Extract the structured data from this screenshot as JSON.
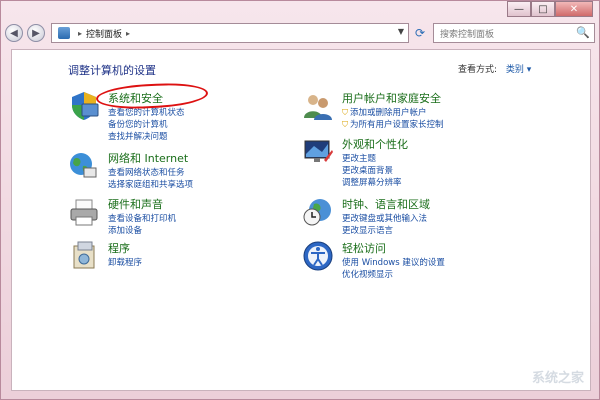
{
  "window": {
    "caption": {
      "minimize": "—",
      "maximize": "□",
      "close": "✕"
    }
  },
  "toolbar": {
    "back_glyph": "◀",
    "forward_glyph": "▶",
    "address_path": [
      "控制面板"
    ],
    "address_sep": "▸",
    "address_drop": "▼",
    "refresh_glyph": "⟳",
    "search_placeholder": "搜索控制面板",
    "search_glyph": "🔍"
  },
  "page": {
    "title": "调整计算机的设置",
    "view_label": "查看方式:",
    "view_value": "类别 ▾"
  },
  "categories": [
    {
      "title": "系统和安全",
      "icon": "shield-icon",
      "links": [
        "查看您的计算机状态",
        "备份您的计算机",
        "查找并解决问题"
      ]
    },
    {
      "title": "网络和 Internet",
      "icon": "network-globe-icon",
      "links": [
        "查看网络状态和任务",
        "选择家庭组和共享选项"
      ]
    },
    {
      "title": "硬件和声音",
      "icon": "printer-icon",
      "links": [
        "查看设备和打印机",
        "添加设备"
      ]
    },
    {
      "title": "程序",
      "icon": "programs-box-icon",
      "links": [
        "卸载程序"
      ]
    },
    {
      "title": "用户帐户和家庭安全",
      "icon": "users-icon",
      "links": [
        "添加或删除用户帐户",
        "为所有用户设置家长控制"
      ]
    },
    {
      "title": "外观和个性化",
      "icon": "display-icon",
      "links": [
        "更改主题",
        "更改桌面背景",
        "调整屏幕分辨率"
      ]
    },
    {
      "title": "时钟、语言和区域",
      "icon": "clock-globe-icon",
      "links": [
        "更改键盘或其他输入法",
        "更改显示语言"
      ]
    },
    {
      "title": "轻松访问",
      "icon": "accessibility-icon",
      "links": [
        "使用 Windows 建议的设置",
        "优化视频显示"
      ]
    }
  ],
  "watermark": "系统之家",
  "colors": {
    "accent_link": "#1c4fa3",
    "category_title": "#1a6e1a",
    "annotation": "#dd1111"
  }
}
